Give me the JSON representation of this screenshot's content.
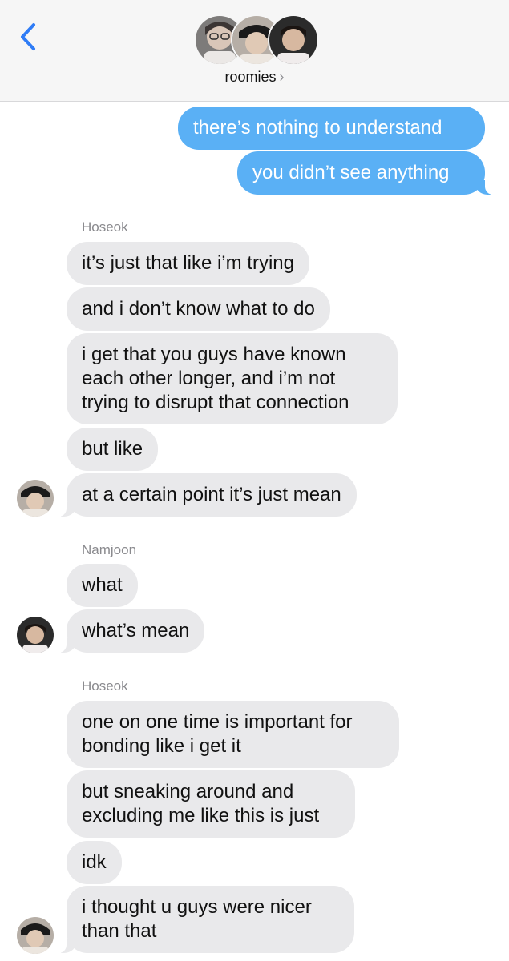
{
  "header": {
    "group_name": "roomies",
    "chevron": "›"
  },
  "icons": {
    "back": "chevron-left-icon",
    "header_chevron": "chevron-right-icon"
  },
  "colors": {
    "outgoing_bubble": "#5ab0f5",
    "incoming_bubble": "#e9e9eb",
    "back_icon": "#2f7cf6",
    "sender_name": "#8a8a8e"
  },
  "messages": {
    "out1": "there’s nothing to understand",
    "out2": "you didn’t see anything",
    "sender1": "Hoseok",
    "h1": "it’s just that like i’m trying",
    "h2": "and i don’t know what to do",
    "h3_l1": "i get that you guys have known",
    "h3_l2": "each other longer, and i’m not",
    "h3_l3": "trying to disrupt that connection",
    "h4": "but like",
    "h5": "at a certain point it’s just mean",
    "sender2": "Namjoon",
    "n1": "what",
    "n2": "what’s mean",
    "sender3": "Hoseok",
    "h6_l1": "one on one time is important for",
    "h6_l2": "bonding like i get it",
    "h7_l1": "but sneaking around and",
    "h7_l2": "excluding me like this is just",
    "h8": "idk",
    "h9_l1": "i thought u guys were nicer",
    "h9_l2": "than that"
  }
}
